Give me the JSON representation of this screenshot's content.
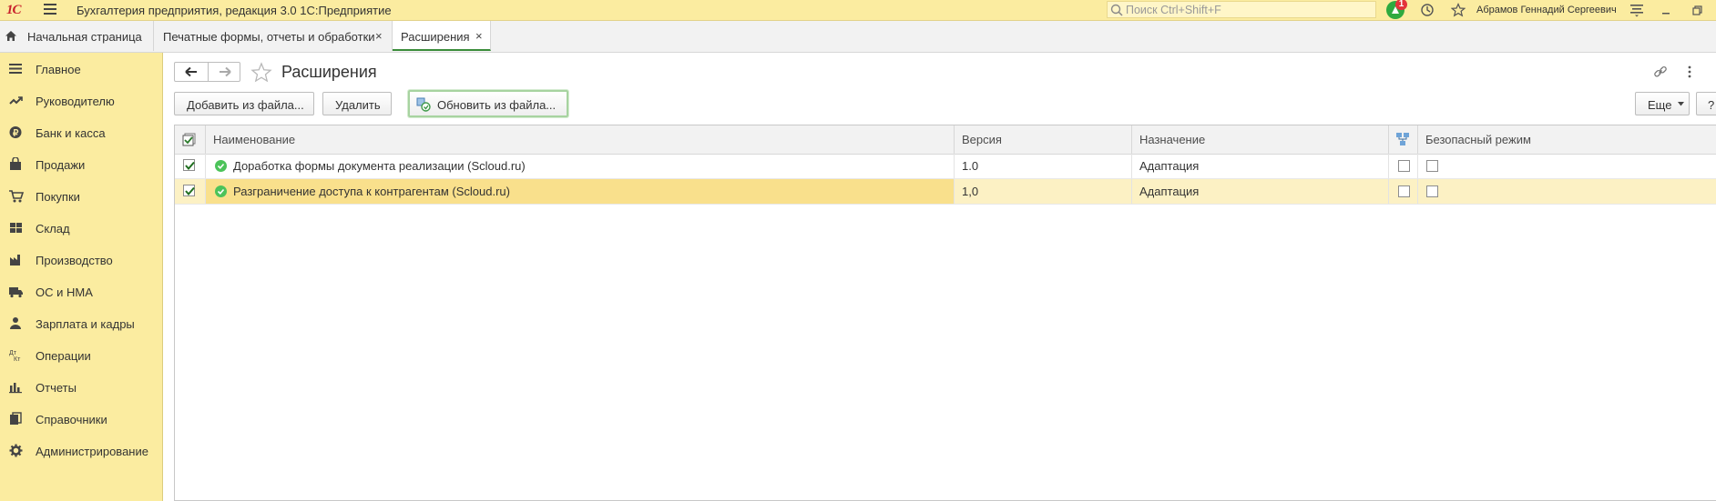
{
  "titlebar": {
    "logo": "1С",
    "title": "Бухгалтерия предприятия, редакция 3.0 1С:Предприятие",
    "search_placeholder": "Поиск Ctrl+Shift+F",
    "notification_count": "1",
    "username": "Абрамов Геннадий Сергеевич"
  },
  "tabs": [
    {
      "label": "Начальная страница"
    },
    {
      "label": "Печатные формы, отчеты и обработки",
      "close": "×"
    },
    {
      "label": "Расширения",
      "close": "×"
    }
  ],
  "sidebar": {
    "items": [
      {
        "label": "Главное",
        "icon": "menu-icon"
      },
      {
        "label": "Руководителю",
        "icon": "trend-icon"
      },
      {
        "label": "Банк и касса",
        "icon": "ruble-icon"
      },
      {
        "label": "Продажи",
        "icon": "bag-icon"
      },
      {
        "label": "Покупки",
        "icon": "cart-icon"
      },
      {
        "label": "Склад",
        "icon": "warehouse-icon"
      },
      {
        "label": "Производство",
        "icon": "factory-icon"
      },
      {
        "label": "ОС и НМА",
        "icon": "truck-icon"
      },
      {
        "label": "Зарплата и кадры",
        "icon": "person-icon"
      },
      {
        "label": "Операции",
        "icon": "dt-kt-icon"
      },
      {
        "label": "Отчеты",
        "icon": "bar-chart-icon"
      },
      {
        "label": "Справочники",
        "icon": "books-icon"
      },
      {
        "label": "Администрирование",
        "icon": "gear-icon"
      }
    ]
  },
  "page": {
    "title": "Расширения"
  },
  "toolbar": {
    "add_label": "Добавить из файла...",
    "delete_label": "Удалить",
    "update_label": "Обновить из файла...",
    "more_label": "Еще",
    "help_label": "?"
  },
  "grid": {
    "columns": {
      "name": "Наименование",
      "version": "Версия",
      "purpose": "Назначение",
      "safe_mode": "Безопасный режим"
    },
    "rows": [
      {
        "active": true,
        "name": "Доработка формы документа реализации (Scloud.ru)",
        "version": "1.0",
        "purpose": "Адаптация",
        "flag": false,
        "safe_mode": false
      },
      {
        "active": true,
        "name": "Разграничение доступа к контрагентам (Scloud.ru)",
        "version": "1,0",
        "purpose": "Адаптация",
        "flag": false,
        "safe_mode": false
      }
    ]
  },
  "colors": {
    "panel_yellow": "#fbeca0",
    "selected_row": "#fcf1c4",
    "selected_cell": "#f9e08c",
    "accent_green": "#3a8c3a",
    "logo_red": "#c8202b"
  }
}
